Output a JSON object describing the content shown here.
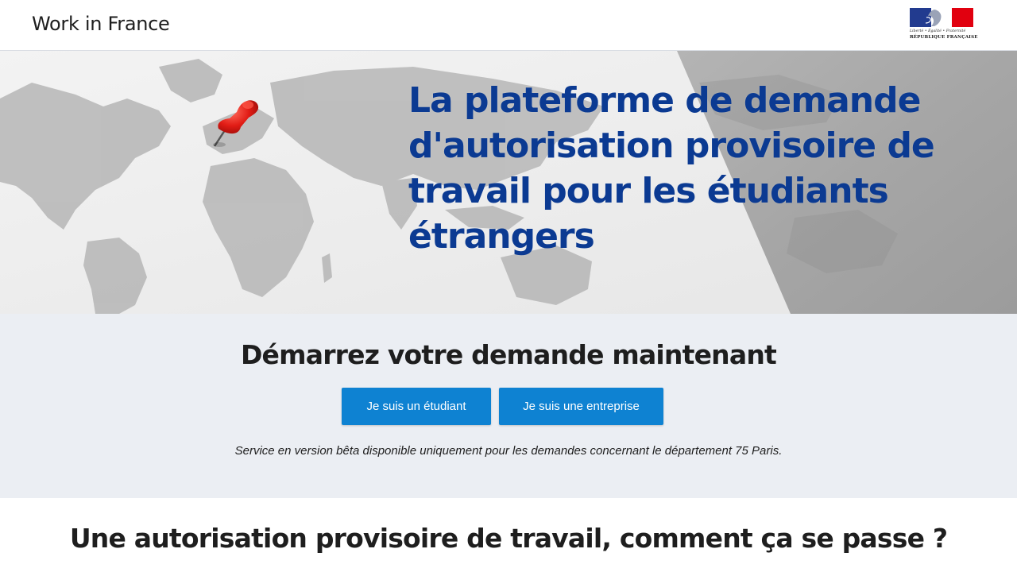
{
  "header": {
    "site_title": "Work in France",
    "gov_logo": {
      "motto": "Liberté • Égalité • Fraternité",
      "name": "RÉPUBLIQUE FRANÇAISE"
    }
  },
  "hero": {
    "title": "La plateforme de demande d'autorisation provisoire de travail pour les étudiants étrangers",
    "image": "world-map-with-red-pin"
  },
  "cta": {
    "title": "Démarrez votre demande maintenant",
    "student_button": "Je suis un étudiant",
    "company_button": "Je suis une entreprise",
    "note": "Service en version bêta disponible uniquement pour les demandes concernant le département 75 Paris."
  },
  "how": {
    "title": "Une autorisation provisoire de travail, comment ça se passe ?"
  },
  "colors": {
    "hero_title": "#0b3a92",
    "button": "#0e82d2",
    "cta_background": "#ebeef3",
    "flag_blue": "#223b8f",
    "flag_red": "#e1000f"
  }
}
